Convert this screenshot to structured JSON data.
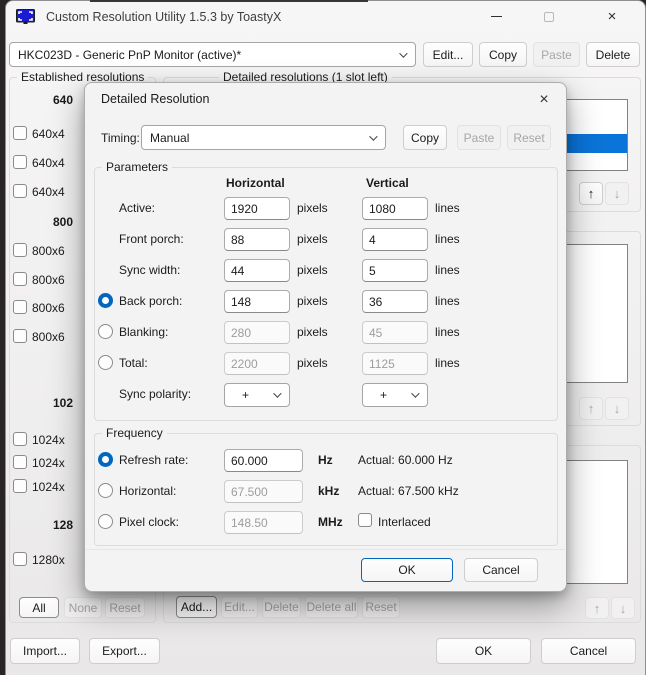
{
  "window": {
    "title": "Custom Resolution Utility 1.5.3 by ToastyX"
  },
  "icons": {
    "close": "×",
    "up_arrow": "↑",
    "down_arrow": "↓"
  },
  "colors": {
    "accent": "#0067c0",
    "list_selection": "#0b74d9",
    "app_icon_blue": "#1b1bd4"
  },
  "toolbar": {
    "monitor_select_value": "HKC023D - Generic PnP Monitor (active)*",
    "edit_label": "Edit...",
    "copy_label": "Copy",
    "paste_label": "Paste",
    "delete_label": "Delete"
  },
  "established": {
    "label": "Established resolutions",
    "groups": [
      {
        "header": "640",
        "items": [
          "640x4",
          "640x4",
          "640x4"
        ]
      },
      {
        "header": "800",
        "items": [
          "800x6",
          "800x6",
          "800x6",
          "800x6"
        ]
      },
      {
        "header": "102",
        "items": [
          "1024x",
          "1024x",
          "1024x"
        ]
      },
      {
        "header": "128",
        "items": [
          "1280x"
        ]
      }
    ],
    "all_label": "All",
    "none_label": "None",
    "reset_label": "Reset"
  },
  "detailed_list": {
    "label": "Detailed resolutions (1 slot left)"
  },
  "list_buttons": {
    "add_label": "Add...",
    "edit_label": "Edit...",
    "delete_label": "Delete",
    "delete_all_label": "Delete all",
    "reset_label": "Reset"
  },
  "footer": {
    "import_label": "Import...",
    "export_label": "Export...",
    "ok_label": "OK",
    "cancel_label": "Cancel"
  },
  "dialog": {
    "title": "Detailed Resolution",
    "timing": {
      "label": "Timing:",
      "value": "Manual",
      "copy_label": "Copy",
      "paste_label": "Paste",
      "reset_label": "Reset"
    },
    "parameters": {
      "label": "Parameters",
      "horizontal_header": "Horizontal",
      "vertical_header": "Vertical",
      "rows": [
        {
          "label": "Active:",
          "h": "1920",
          "h_unit": "pixels",
          "v": "1080",
          "v_unit": "lines"
        },
        {
          "label": "Front porch:",
          "h": "88",
          "h_unit": "pixels",
          "v": "4",
          "v_unit": "lines"
        },
        {
          "label": "Sync width:",
          "h": "44",
          "h_unit": "pixels",
          "v": "5",
          "v_unit": "lines"
        },
        {
          "label": "Back porch:",
          "h": "148",
          "h_unit": "pixels",
          "v": "36",
          "v_unit": "lines"
        },
        {
          "label": "Blanking:",
          "h": "280",
          "h_unit": "pixels",
          "v": "45",
          "v_unit": "lines"
        },
        {
          "label": "Total:",
          "h": "2200",
          "h_unit": "pixels",
          "v": "1125",
          "v_unit": "lines"
        }
      ],
      "sync_polarity": {
        "label": "Sync polarity:",
        "h_value": "+",
        "v_value": "+"
      }
    },
    "frequency": {
      "label": "Frequency",
      "rows": [
        {
          "label": "Refresh rate:",
          "value": "60.000",
          "unit": "Hz",
          "actual": "Actual: 60.000 Hz"
        },
        {
          "label": "Horizontal:",
          "value": "67.500",
          "unit": "kHz",
          "actual": "Actual: 67.500 kHz"
        },
        {
          "label": "Pixel clock:",
          "value": "148.50",
          "unit": "MHz"
        }
      ],
      "interlaced_label": "Interlaced"
    },
    "ok_label": "OK",
    "cancel_label": "Cancel"
  }
}
